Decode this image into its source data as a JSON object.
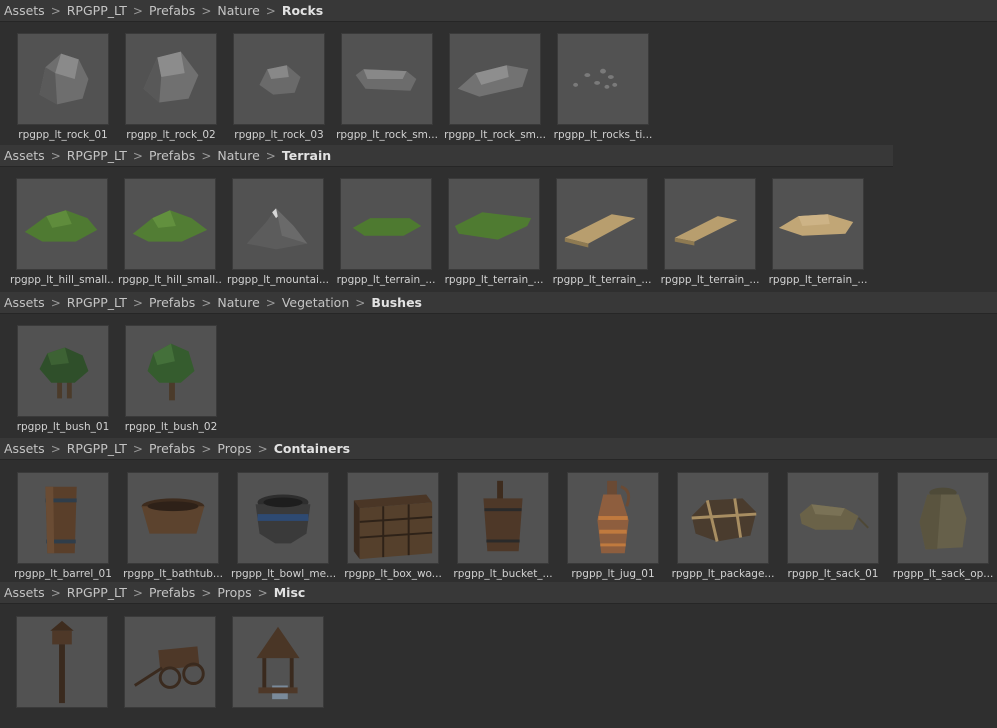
{
  "sections": [
    {
      "breadcrumb": [
        "Assets",
        "RPGPP_LT",
        "Prefabs",
        "Nature",
        "Rocks"
      ],
      "items": [
        {
          "label": "rpgpp_lt_rock_01",
          "icon": "rock-icon"
        },
        {
          "label": "rpgpp_lt_rock_02",
          "icon": "rock-icon"
        },
        {
          "label": "rpgpp_lt_rock_03",
          "icon": "rock-icon"
        },
        {
          "label": "rpgpp_lt_rock_sm...",
          "icon": "flat-rock-icon"
        },
        {
          "label": "rpgpp_lt_rock_sm...",
          "icon": "flat-rock-icon"
        },
        {
          "label": "rpgpp_lt_rocks_ti...",
          "icon": "pebbles-icon"
        }
      ]
    },
    {
      "breadcrumb": [
        "Assets",
        "RPGPP_LT",
        "Prefabs",
        "Nature",
        "Terrain"
      ],
      "items": [
        {
          "label": "rpgpp_lt_hill_small...",
          "icon": "hill-icon"
        },
        {
          "label": "rpgpp_lt_hill_small...",
          "icon": "hill-icon"
        },
        {
          "label": "rpgpp_lt_mountai...",
          "icon": "mountain-icon"
        },
        {
          "label": "rpgpp_lt_terrain_...",
          "icon": "grass-patch-icon"
        },
        {
          "label": "rpgpp_lt_terrain_...",
          "icon": "grass-patch-icon"
        },
        {
          "label": "rpgpp_lt_terrain_...",
          "icon": "sand-patch-icon"
        },
        {
          "label": "rpgpp_lt_terrain_...",
          "icon": "sand-patch-icon"
        },
        {
          "label": "rpgpp_lt_terrain_...",
          "icon": "sand-mound-icon"
        }
      ]
    },
    {
      "breadcrumb": [
        "Assets",
        "RPGPP_LT",
        "Prefabs",
        "Nature",
        "Vegetation",
        "Bushes"
      ],
      "items": [
        {
          "label": "rpgpp_lt_bush_01",
          "icon": "bush-icon"
        },
        {
          "label": "rpgpp_lt_bush_02",
          "icon": "bush-icon"
        }
      ]
    },
    {
      "breadcrumb": [
        "Assets",
        "RPGPP_LT",
        "Prefabs",
        "Props",
        "Containers"
      ],
      "items": [
        {
          "label": "rpgpp_lt_barrel_01",
          "icon": "barrel-icon"
        },
        {
          "label": "rpgpp_lt_bathtub...",
          "icon": "bathtub-icon"
        },
        {
          "label": "rpgpp_lt_bowl_me...",
          "icon": "bowl-icon"
        },
        {
          "label": "rpgpp_lt_box_wo...",
          "icon": "crate-icon"
        },
        {
          "label": "rpgpp_lt_bucket_...",
          "icon": "bucket-icon"
        },
        {
          "label": "rpgpp_lt_jug_01",
          "icon": "jug-icon"
        },
        {
          "label": "rpgpp_lt_package...",
          "icon": "package-icon"
        },
        {
          "label": "rpgpp_lt_sack_01",
          "icon": "sack-icon"
        },
        {
          "label": "rpgpp_lt_sack_op...",
          "icon": "open-sack-icon"
        }
      ]
    },
    {
      "breadcrumb": [
        "Assets",
        "RPGPP_LT",
        "Prefabs",
        "Props",
        "Misc"
      ],
      "items": [
        {
          "label": "",
          "icon": "signpost-icon"
        },
        {
          "label": "",
          "icon": "cart-icon"
        },
        {
          "label": "",
          "icon": "well-icon"
        }
      ]
    }
  ]
}
